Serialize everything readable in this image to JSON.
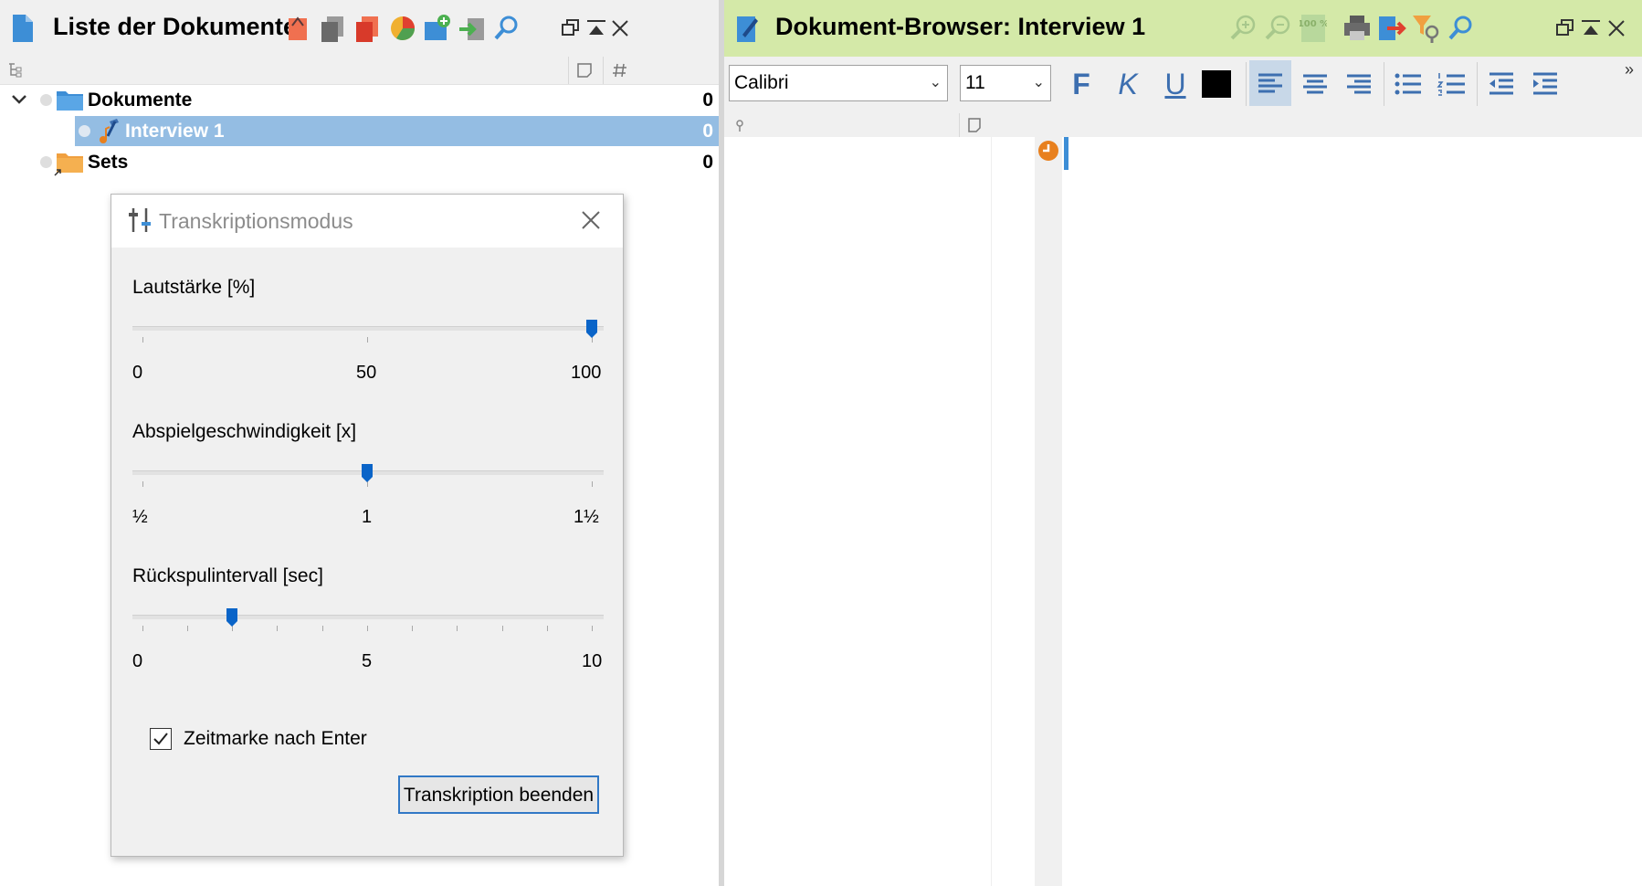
{
  "left_panel": {
    "title": "Liste der Dokumente",
    "icons": [
      "activate-icon",
      "copy-icon",
      "duplicate-icon",
      "chart-icon",
      "new-folder-icon",
      "import-icon",
      "search-icon"
    ],
    "tree": [
      {
        "label": "Dokumente",
        "count": "0"
      },
      {
        "label": "Interview 1",
        "count": "0"
      },
      {
        "label": "Sets",
        "count": "0"
      }
    ]
  },
  "dialog": {
    "title": "Transkriptionsmodus",
    "volume": {
      "label": "Lautstärke [%]",
      "min": "0",
      "mid": "50",
      "max": "100",
      "value": 100
    },
    "speed": {
      "label": "Abspielgeschwindigkeit [x]",
      "min": "½",
      "mid": "1",
      "max": "1½",
      "value": 1
    },
    "rewind": {
      "label": "Rückspulintervall [sec]",
      "min": "0",
      "mid": "5",
      "max": "10",
      "value": 2
    },
    "checkbox_label": "Zeitmarke nach Enter",
    "checkbox_checked": true,
    "end_button": "Transkription beenden"
  },
  "right_panel": {
    "title": "Dokument-Browser: Interview 1",
    "font": "Calibri",
    "font_size": "11",
    "bold": "F",
    "italic": "K",
    "underline": "U",
    "more": "»",
    "zoom_100": "100 %",
    "title_bar_color": "#d4e9a8"
  },
  "colors": {
    "accent": "#0a64c8",
    "selection": "#94bde3",
    "orange": "#e8801e",
    "folder_blue": "#3d8ed6"
  }
}
